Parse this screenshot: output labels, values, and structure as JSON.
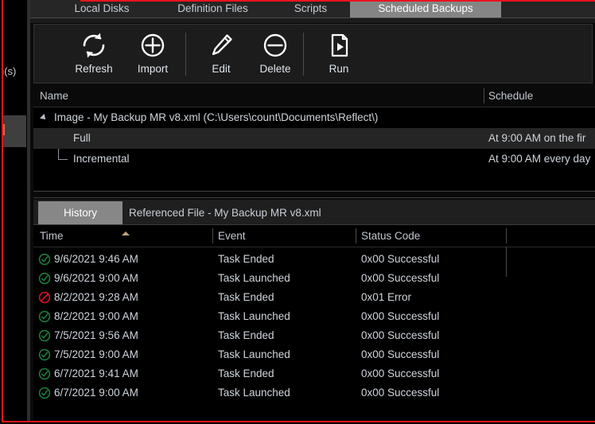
{
  "tabs": {
    "items": [
      {
        "label": "Local Disks",
        "active": false
      },
      {
        "label": "Definition Files",
        "active": false
      },
      {
        "label": "Scripts",
        "active": false
      },
      {
        "label": "Scheduled Backups",
        "active": true
      }
    ]
  },
  "left_panel": {
    "cut_label": "n(s)"
  },
  "toolbar": {
    "refresh_label": "Refresh",
    "import_label": "Import",
    "edit_label": "Edit",
    "delete_label": "Delete",
    "run_label": "Run"
  },
  "schedules_grid": {
    "columns": {
      "name": "Name",
      "schedule": "Schedule"
    },
    "rows": [
      {
        "name": "Image - My Backup MR v8.xml (C:\\Users\\count\\Documents\\Reflect\\)",
        "schedule": "",
        "level": "root",
        "selected": false
      },
      {
        "name": "Full",
        "schedule": "At 9:00 AM on the fir",
        "level": "child",
        "selected": true
      },
      {
        "name": "Incremental",
        "schedule": "At 9:00 AM every day",
        "level": "child",
        "selected": false
      }
    ]
  },
  "bottom_tabs": {
    "items": [
      {
        "label": "History",
        "active": true
      },
      {
        "label": "Referenced File - My Backup MR v8.xml",
        "active": false
      }
    ]
  },
  "history_grid": {
    "columns": {
      "time": "Time",
      "event": "Event",
      "status": "Status Code"
    },
    "sort": "ascending",
    "rows": [
      {
        "icon": "success",
        "time": "9/6/2021 9:46 AM",
        "event": "Task Ended",
        "status": "0x00 Successful"
      },
      {
        "icon": "success",
        "time": "9/6/2021 9:00 AM",
        "event": "Task Launched",
        "status": "0x00 Successful"
      },
      {
        "icon": "error",
        "time": "8/2/2021 9:28 AM",
        "event": "Task Ended",
        "status": "0x01 Error"
      },
      {
        "icon": "success",
        "time": "8/2/2021 9:00 AM",
        "event": "Task Launched",
        "status": "0x00 Successful"
      },
      {
        "icon": "success",
        "time": "7/5/2021 9:56 AM",
        "event": "Task Ended",
        "status": "0x00 Successful"
      },
      {
        "icon": "success",
        "time": "7/5/2021 9:00 AM",
        "event": "Task Launched",
        "status": "0x00 Successful"
      },
      {
        "icon": "success",
        "time": "6/7/2021 9:41 AM",
        "event": "Task Ended",
        "status": "0x00 Successful"
      },
      {
        "icon": "success",
        "time": "6/7/2021 9:00 AM",
        "event": "Task Launched",
        "status": "0x00 Successful"
      }
    ]
  },
  "colors": {
    "accent_red": "#e8141e",
    "success_green": "#1d7a3a",
    "error_red": "#cc1122",
    "active_tab": "#858585",
    "background": "#000000"
  }
}
